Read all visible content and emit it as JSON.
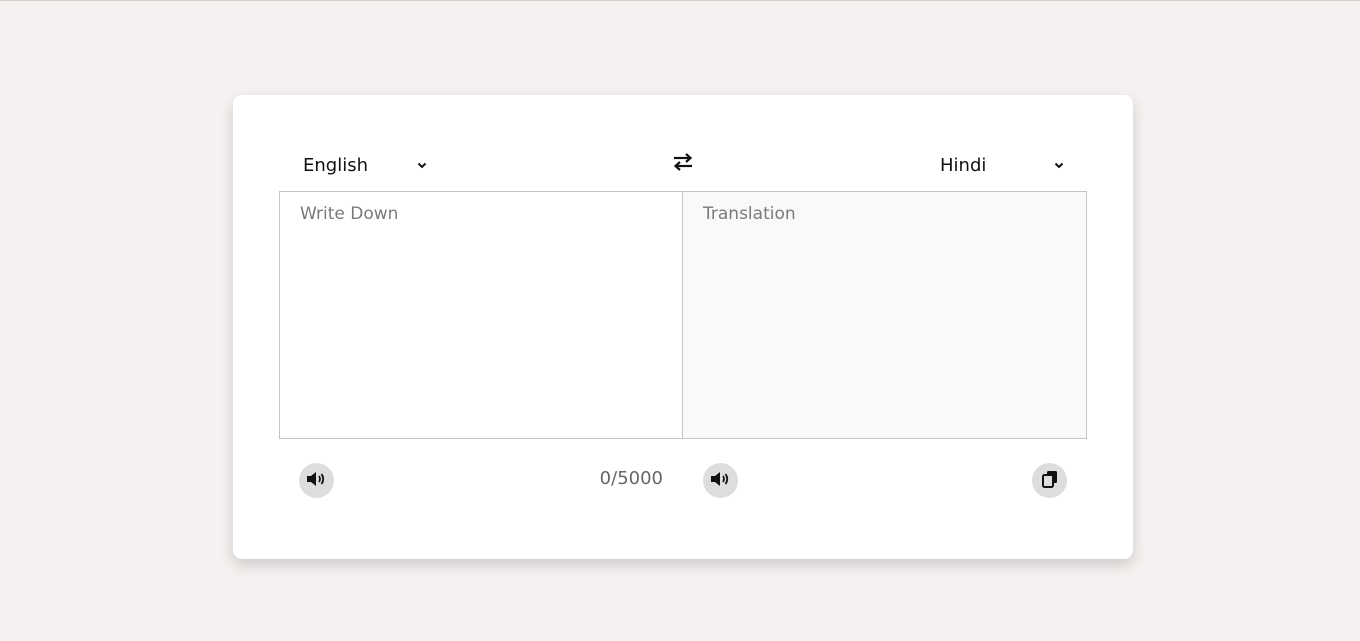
{
  "languages": {
    "from": {
      "selected": "English"
    },
    "to": {
      "selected": "Hindi"
    }
  },
  "input": {
    "placeholder": "Write Down",
    "value": ""
  },
  "output": {
    "placeholder": "Translation",
    "value": ""
  },
  "char_count": "0/5000",
  "icons": {
    "swap": "swap-arrows-icon",
    "speaker": "speaker-icon",
    "copy": "copy-icon",
    "chevron": "chevron-down-icon"
  },
  "colors": {
    "page_background": "#f5f1f0",
    "card_background": "#ffffff",
    "icon_button_background": "#dddddd",
    "output_background": "#f9f9f9"
  }
}
